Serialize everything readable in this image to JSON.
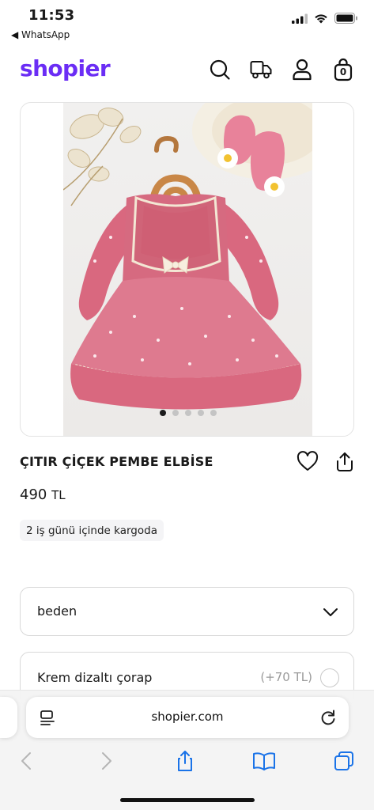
{
  "status_bar": {
    "time": "11:53",
    "back_app": "◀ WhatsApp"
  },
  "header": {
    "logo": "shopier",
    "icons": [
      "search-icon",
      "truck-icon",
      "user-icon",
      "bag-icon"
    ],
    "cart_count": "0",
    "brand_color": "#6b2df5"
  },
  "gallery": {
    "image_count": 5,
    "active_index": 0
  },
  "product": {
    "title": "ÇITIR ÇİÇEK PEMBE ELBİSE",
    "price_value": "490",
    "price_currency": "TL",
    "shipping_note": "2 iş günü içinde kargoda"
  },
  "options": {
    "size_select_label": "beden",
    "addon_label": "Krem dizaltı çorap",
    "addon_price": "(+70 TL)"
  },
  "browser": {
    "url": "shopier.com"
  }
}
